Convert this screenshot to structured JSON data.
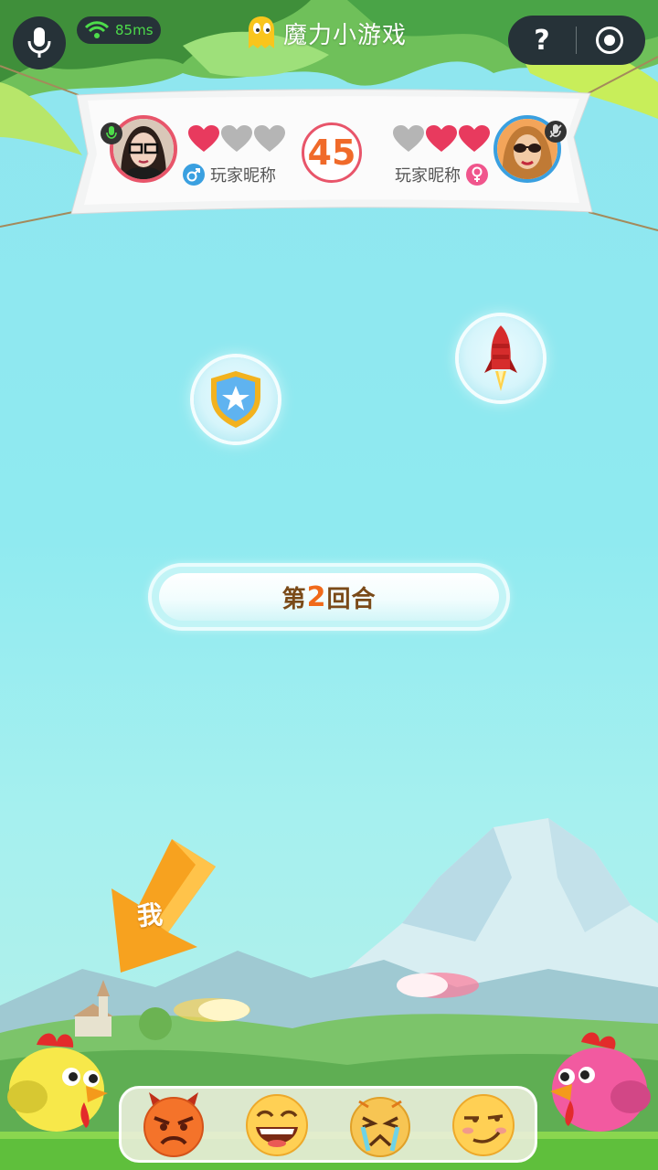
{
  "topbar": {
    "ping": "85ms",
    "app_title": "魔力小游戏",
    "help_label": "?"
  },
  "players": {
    "left": {
      "name": "玩家昵称",
      "gender": "male",
      "hearts_remaining": 1,
      "hearts_total": 3,
      "mic": "on"
    },
    "right": {
      "name": "玩家昵称",
      "gender": "female",
      "hearts_remaining": 2,
      "hearts_total": 3,
      "mic": "muted"
    }
  },
  "timer": "45",
  "powerups": [
    {
      "name": "shield-icon"
    },
    {
      "name": "rocket-icon"
    }
  ],
  "round": {
    "prefix": "第",
    "number": "2",
    "suffix": "回合"
  },
  "me_label": "我",
  "emojis": [
    "angry-devil-emoji",
    "laughing-emoji",
    "frustrated-emoji",
    "smirk-emoji"
  ],
  "colors": {
    "heart_active": "#e83a5e",
    "heart_inactive": "#b5b5b5",
    "timer_text": "#f06a2a",
    "round_number": "#f06a1a",
    "ping": "#4ddc4a"
  }
}
